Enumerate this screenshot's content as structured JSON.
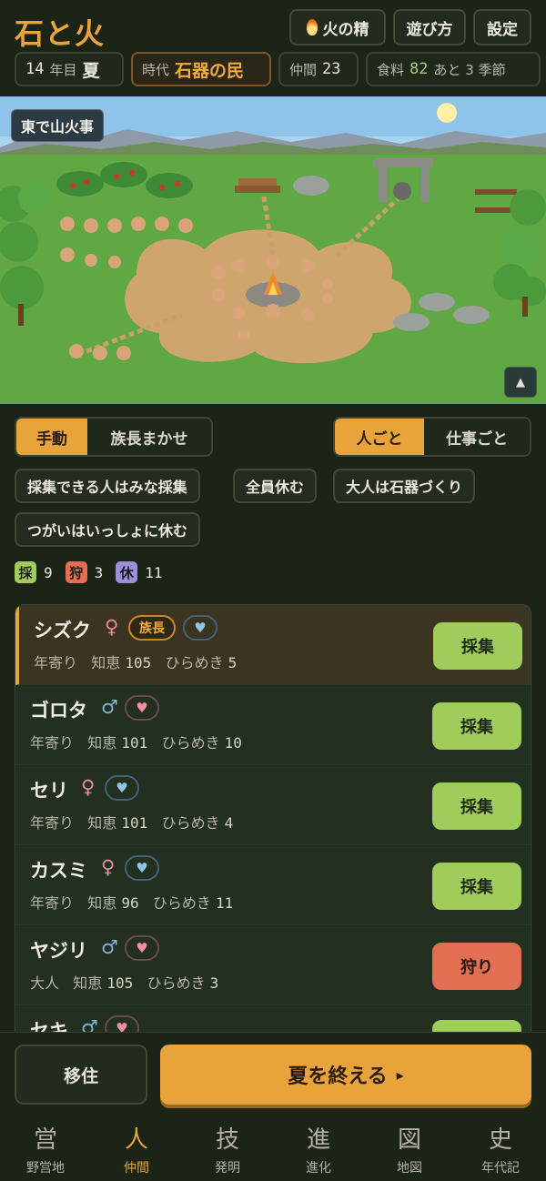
{
  "header": {
    "title": "石と火",
    "buttons": {
      "spirit": "火の精",
      "howto": "遊び方",
      "settings": "設定"
    },
    "year": {
      "value": "14",
      "unit": "年目",
      "season": "夏"
    },
    "era": {
      "label": "時代",
      "value": "石器の民"
    },
    "members": {
      "label": "仲間",
      "value": "23"
    },
    "food": {
      "label": "食料",
      "value": "82",
      "remain": "あと 3 季節"
    }
  },
  "scene": {
    "event": "東で山火事",
    "collapse": "▲"
  },
  "mode_toggle": {
    "manual": "手動",
    "auto": "族長まかせ",
    "selected": "manual"
  },
  "view_toggle": {
    "person": "人ごと",
    "job": "仕事ごと",
    "selected": "person"
  },
  "presets": [
    "採集できる人はみな採集",
    "全員休む",
    "大人は石器づくり",
    "つがいはいっしょに休む"
  ],
  "counts": [
    {
      "key": "採",
      "value": "9",
      "color": "#a0cc5c"
    },
    {
      "key": "狩",
      "value": "3",
      "color": "#e36f52"
    },
    {
      "key": "休",
      "value": "11",
      "color": "#9b8fd8"
    }
  ],
  "people": [
    {
      "name": "シズク",
      "sex": "♀",
      "sex_type": "f",
      "chief": "族長",
      "heart": "♥",
      "heart_type": "blue",
      "age": "年寄り",
      "wis_label": "知恵",
      "wis": "105",
      "insp_label": "ひらめき",
      "insp": "5",
      "job": "採集",
      "job_type": "gather"
    },
    {
      "name": "ゴロタ",
      "sex": "♂",
      "sex_type": "m",
      "heart": "♥",
      "heart_type": "pink",
      "age": "年寄り",
      "wis_label": "知恵",
      "wis": "101",
      "insp_label": "ひらめき",
      "insp": "10",
      "job": "採集",
      "job_type": "gather"
    },
    {
      "name": "セリ",
      "sex": "♀",
      "sex_type": "f",
      "heart": "♥",
      "heart_type": "blue",
      "age": "年寄り",
      "wis_label": "知恵",
      "wis": "101",
      "insp_label": "ひらめき",
      "insp": "4",
      "job": "採集",
      "job_type": "gather"
    },
    {
      "name": "カスミ",
      "sex": "♀",
      "sex_type": "f",
      "heart": "♥",
      "heart_type": "blue",
      "age": "年寄り",
      "wis_label": "知恵",
      "wis": "96",
      "insp_label": "ひらめき",
      "insp": "11",
      "job": "採集",
      "job_type": "gather"
    },
    {
      "name": "ヤジリ",
      "sex": "♂",
      "sex_type": "m",
      "heart": "♥",
      "heart_type": "pink",
      "age": "大人",
      "wis_label": "知恵",
      "wis": "105",
      "insp_label": "ひらめき",
      "insp": "3",
      "job": "狩り",
      "job_type": "hunt"
    },
    {
      "name": "セキ",
      "sex": "♂",
      "sex_type": "m",
      "heart": "♥",
      "heart_type": "pink",
      "age": "",
      "wis_label": "",
      "wis": "",
      "insp_label": "",
      "insp": "",
      "job": "",
      "job_type": "gather"
    }
  ],
  "actions": {
    "move": "移住",
    "end_season": "夏を終える",
    "end_arrow": "▸"
  },
  "nav": [
    {
      "glyph": "営",
      "label": "野営地"
    },
    {
      "glyph": "人",
      "label": "仲間",
      "active": true
    },
    {
      "glyph": "技",
      "label": "発明"
    },
    {
      "glyph": "進",
      "label": "進化"
    },
    {
      "glyph": "図",
      "label": "地図"
    },
    {
      "glyph": "史",
      "label": "年代記"
    }
  ]
}
